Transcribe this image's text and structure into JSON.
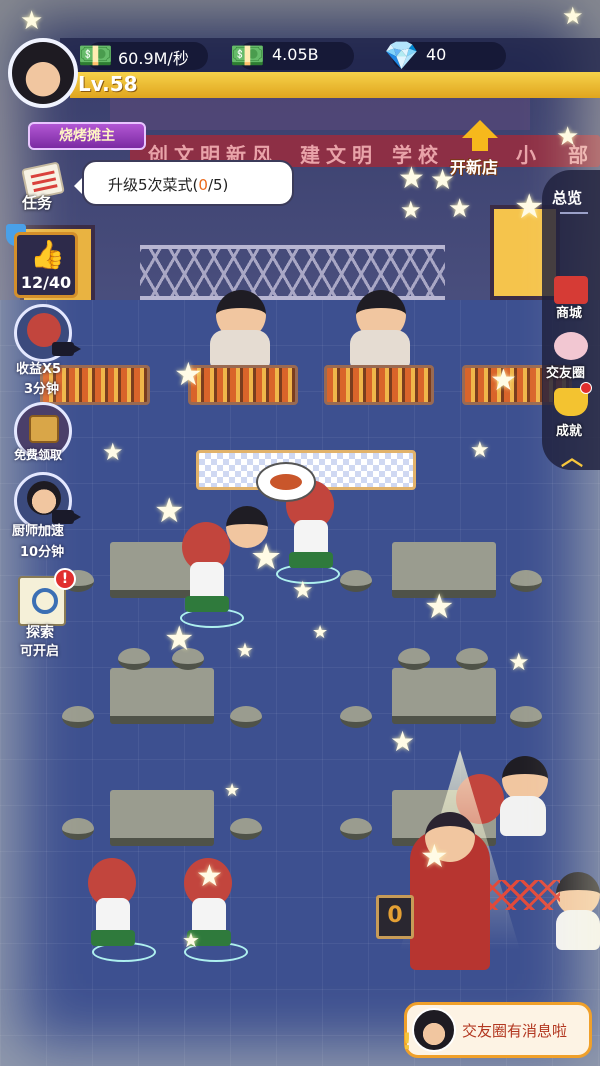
{
  "hud": {
    "income_rate": "60.9M/秒",
    "cash": "4.05B",
    "diamonds": "40",
    "level": "Lv.58"
  },
  "player": {
    "title_badge": "烧烤摊主"
  },
  "task": {
    "label": "任务",
    "prefix": "升级5次菜式(",
    "progress": "0",
    "suffix": "/5)"
  },
  "likes": {
    "count": "12/40"
  },
  "side_buttons": {
    "income_boost_label": "收益X5",
    "income_boost_timer": "3分钟",
    "free_claim_label": "免费领取",
    "chef_speed_label": "厨师加速",
    "chef_speed_timer": "10分钟",
    "explore_label": "探索",
    "explore_status": "可开启"
  },
  "right_menu": {
    "new_shop": "开新店",
    "overview": "总览",
    "mall": "商城",
    "friends": "交友圈",
    "achievements": "成就"
  },
  "scene": {
    "banner_text_1": "创",
    "banner_text_2": "文明新风",
    "banner_text_3": "建",
    "banner_text_4": "文明",
    "banner_text_5": "学校",
    "banner_text_6": "小",
    "banner_text_7": "部",
    "counter_board": "0"
  },
  "notification": {
    "text": "交友圈有消息啦",
    "alert_mark": "!"
  },
  "icons": {
    "cash_icon": "cash-stack-icon",
    "diamond_icon": "diamond-icon",
    "like_icon": "thumbs-up-icon"
  },
  "colors": {
    "level_bar": "#f6d24a",
    "task_progress": "#ea6a1c",
    "badge": "#7b2aa2",
    "alert": "#e12e2e"
  }
}
